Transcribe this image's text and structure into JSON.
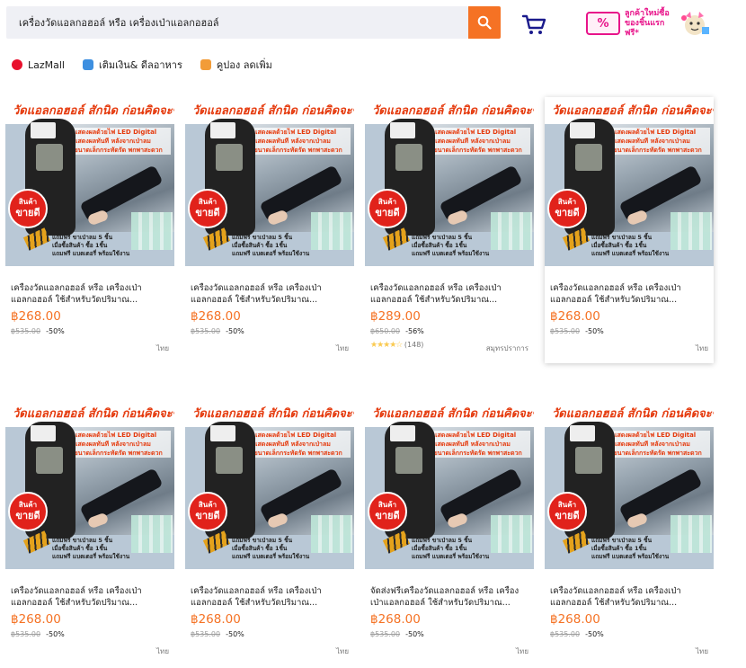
{
  "search": {
    "value": "เครื่องวัดแอลกอฮอล์ หรือ เครื่องเป่าแอลกอฮอล์"
  },
  "promo": {
    "coupon_glyph": "%",
    "text": "ลูกค้าใหม่ซื้อของชิ้นแรกฟรี*"
  },
  "quick_links": [
    {
      "label": "LazMall",
      "icon": "lazmall-icon",
      "color": "#e8112d"
    },
    {
      "label": "เติมเงิน& ดีลอาหาร",
      "icon": "topup-icon",
      "color": "#3d8fe0"
    },
    {
      "label": "คูปอง ลดเพิ่ม",
      "icon": "coupon-icon",
      "color": "#f29c38"
    }
  ],
  "product_image": {
    "headline": "วัดแอลกอฮอล์ สักนิด ก่อนคิดจะขับรถ",
    "features": [
      "แสดงผลด้วยไฟ LED Digital",
      "แสดงผลทันที หลังจากเป่าลม",
      "ขนาดเล็กกระทัดรัด พกพาสะดวก"
    ],
    "badge_top": "สินค้า",
    "badge_bottom": "ขายดี",
    "bottom_lines": [
      "แถมฟรี ขาเป่าลม 5 ชิ้น",
      "เมื่อซื้อสินค้า ซื้อ 1ชิ้น",
      "แถมฟรี แบตเตอรี่ พร้อมใช้งาน"
    ]
  },
  "products": [
    {
      "title": "เครื่องวัดแอลกอฮอล์ หรือ เครื่องเป่าแอลกอฮอล์ ใช้สำหรับวัดปริมาณ...",
      "price": "฿268.00",
      "old_price": "฿535.00",
      "discount": "-50%",
      "location": "ไทย",
      "rating": "",
      "reviews": ""
    },
    {
      "title": "เครื่องวัดแอลกอฮอล์ หรือ เครื่องเป่าแอลกอฮอล์ ใช้สำหรับวัดปริมาณ...",
      "price": "฿268.00",
      "old_price": "฿535.00",
      "discount": "-50%",
      "location": "ไทย",
      "rating": "",
      "reviews": ""
    },
    {
      "title": "เครื่องวัดแอลกอฮอล์ หรือ เครื่องเป่าแอลกอฮอล์ ใช้สำหรับวัดปริมาณ...",
      "price": "฿289.00",
      "old_price": "฿650.00",
      "discount": "-56%",
      "location": "สมุทรปราการ",
      "rating": "★★★★☆",
      "reviews": "(148)"
    },
    {
      "title": "เครื่องวัดแอลกอฮอล์ หรือ เครื่องเป่าแอลกอฮอล์ ใช้สำหรับวัดปริมาณ...",
      "price": "฿268.00",
      "old_price": "฿535.00",
      "discount": "-50%",
      "location": "ไทย",
      "rating": "",
      "reviews": ""
    },
    {
      "title": "เครื่องวัดแอลกอฮอล์ หรือ เครื่องเป่าแอลกอฮอล์ ใช้สำหรับวัดปริมาณ...",
      "price": "฿268.00",
      "old_price": "฿535.00",
      "discount": "-50%",
      "location": "ไทย",
      "rating": "",
      "reviews": ""
    },
    {
      "title": "เครื่องวัดแอลกอฮอล์ หรือ เครื่องเป่าแอลกอฮอล์ ใช้สำหรับวัดปริมาณ...",
      "price": "฿268.00",
      "old_price": "฿535.00",
      "discount": "-50%",
      "location": "ไทย",
      "rating": "",
      "reviews": ""
    },
    {
      "title": "จัดส่งฟรีเครื่องวัดแอลกอฮอล์ หรือ เครื่องเป่าแอลกอฮอล์ ใช้สำหรับวัดปริมาณ...",
      "price": "฿268.00",
      "old_price": "฿535.00",
      "discount": "-50%",
      "location": "ไทย",
      "rating": "",
      "reviews": ""
    },
    {
      "title": "เครื่องวัดแอลกอฮอล์ หรือ เครื่องเป่าแอลกอฮอล์ ใช้สำหรับวัดปริมาณ...",
      "price": "฿268.00",
      "old_price": "฿535.00",
      "discount": "-50%",
      "location": "ไทย",
      "rating": "",
      "reviews": ""
    }
  ],
  "colors": {
    "accent": "#f57224",
    "price": "#f57224",
    "brand_pink": "#e8148a"
  }
}
